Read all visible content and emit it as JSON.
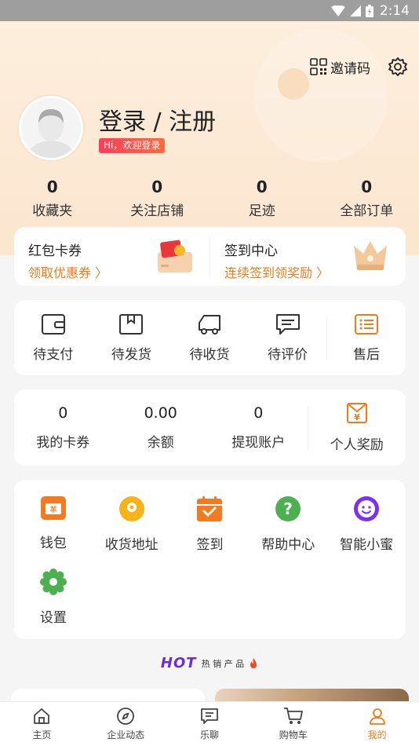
{
  "status_bar": {
    "time": "2:14"
  },
  "header": {
    "invite_label": "邀请码"
  },
  "profile": {
    "login_title": "登录 / 注册",
    "welcome_badge": "Hi，欢迎登录"
  },
  "stats": [
    {
      "value": "0",
      "label": "收藏夹"
    },
    {
      "value": "0",
      "label": "关注店铺"
    },
    {
      "value": "0",
      "label": "足迹"
    },
    {
      "value": "0",
      "label": "全部订单"
    }
  ],
  "promo": {
    "left": {
      "title": "红包卡券",
      "subtitle": "领取优惠券 〉"
    },
    "right": {
      "title": "签到中心",
      "subtitle": "连续签到领奖励 〉"
    }
  },
  "orders": [
    {
      "label": "待支付",
      "icon": "wallet-icon"
    },
    {
      "label": "待发货",
      "icon": "box-icon"
    },
    {
      "label": "待收货",
      "icon": "truck-icon"
    },
    {
      "label": "待评价",
      "icon": "comment-icon"
    },
    {
      "label": "售后",
      "icon": "list-icon"
    }
  ],
  "wallet": [
    {
      "value": "0",
      "label": "我的卡券"
    },
    {
      "value": "0.00",
      "label": "余额"
    },
    {
      "value": "0",
      "label": "提现账户"
    },
    {
      "label": "个人奖励",
      "icon": "reward-icon"
    }
  ],
  "services": [
    {
      "label": "钱包",
      "icon": "wallet-card-icon"
    },
    {
      "label": "收货地址",
      "icon": "location-icon"
    },
    {
      "label": "签到",
      "icon": "calendar-check-icon"
    },
    {
      "label": "帮助中心",
      "icon": "help-icon"
    },
    {
      "label": "智能小蜜",
      "icon": "assistant-icon"
    },
    {
      "label": "设置",
      "icon": "settings-gear-icon"
    }
  ],
  "hot": {
    "word": "HOT",
    "label": "热 销 产 品"
  },
  "tabbar": [
    {
      "label": "主页",
      "icon": "home-icon"
    },
    {
      "label": "企业动态",
      "icon": "compass-icon"
    },
    {
      "label": "乐聊",
      "icon": "chat-icon"
    },
    {
      "label": "购物车",
      "icon": "cart-icon"
    },
    {
      "label": "我的",
      "icon": "user-icon",
      "active": true
    }
  ],
  "colors": {
    "accent": "#f07a1a",
    "badge": "#ff3d5a",
    "hero_bg": "#fdeedd"
  }
}
